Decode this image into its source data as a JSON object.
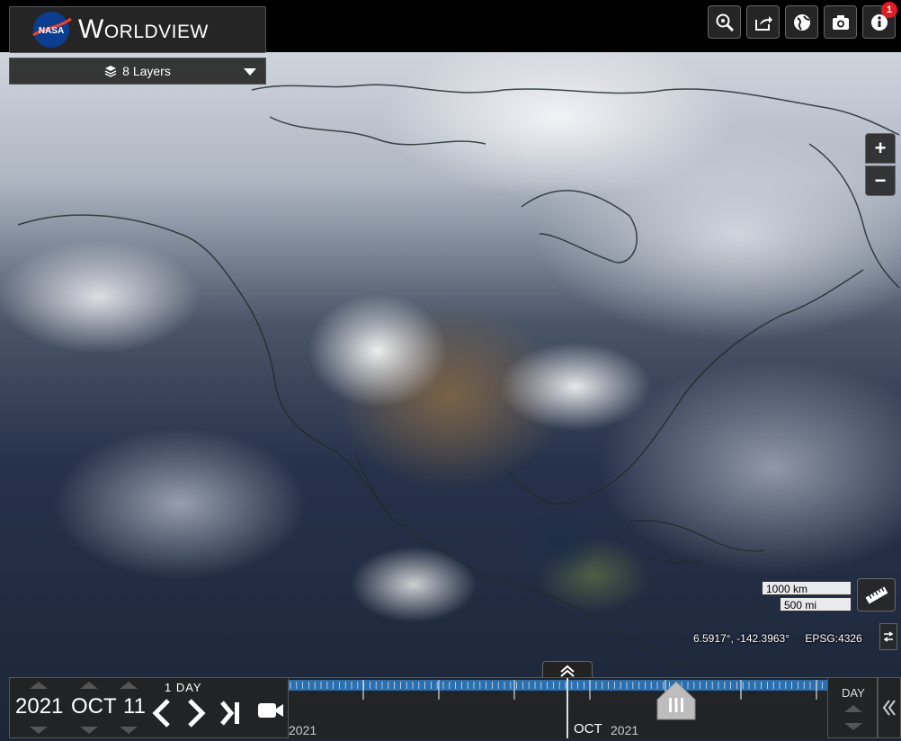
{
  "app": {
    "brand_title": "Worldview",
    "logo_text": "NASA"
  },
  "layers": {
    "label": "8 Layers"
  },
  "toolbar": {
    "buttons": [
      "zoom-search-icon",
      "share-icon",
      "projection-globe-icon",
      "camera-icon",
      "info-icon"
    ],
    "notification_count": "1"
  },
  "zoom": {
    "in_label": "+",
    "out_label": "−"
  },
  "scale": {
    "km": "1000 km",
    "mi": "500 mi"
  },
  "coordinates": {
    "latlon": "6.5917°, -142.3963°",
    "projection": "EPSG:4326"
  },
  "date": {
    "year": "2021",
    "month": "OCT",
    "day": "11",
    "interval": "1  DAY"
  },
  "timeline": {
    "year_left": "2021",
    "month": "OCT",
    "year_right": "2021",
    "zoom_level": "DAY"
  },
  "colors": {
    "panel": "#232323",
    "badge": "#e31b23",
    "timeline_bar": "#2a6fb0",
    "nasa_blue": "#0b3d91",
    "nasa_red": "#fc3d21",
    "coastline": "#1f2d2d"
  }
}
